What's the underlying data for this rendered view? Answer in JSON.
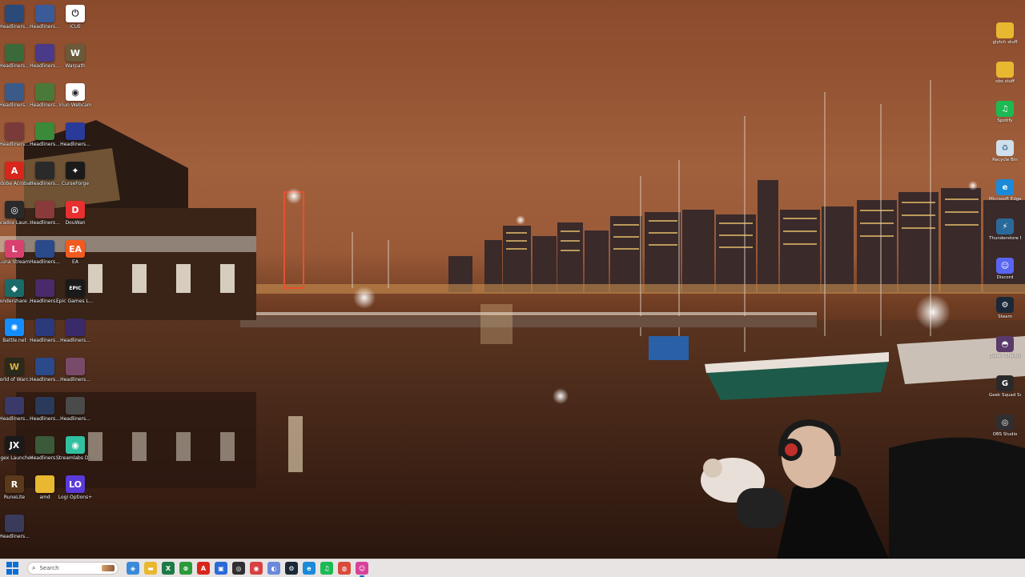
{
  "left_icons": [
    {
      "label": "Headliners...",
      "color": "#2a4a7a",
      "glyph": ""
    },
    {
      "label": "Headliners...",
      "color": "#3a5a9a",
      "glyph": ""
    },
    {
      "label": "iCUE",
      "color": "#ffffff",
      "glyph": "⏻",
      "fg": "#2a2a2a"
    },
    {
      "label": "Headliners...",
      "color": "#3a6a3a",
      "glyph": ""
    },
    {
      "label": "Headliners...",
      "color": "#4a3a8a",
      "glyph": ""
    },
    {
      "label": "Warpath",
      "color": "#6a5a3a",
      "glyph": "W"
    },
    {
      "label": "Headliners...",
      "color": "#3a5a8a",
      "glyph": ""
    },
    {
      "label": "Headliners...",
      "color": "#4a7a3a",
      "glyph": ""
    },
    {
      "label": "Iriun Webcam",
      "color": "#ffffff",
      "glyph": "◉",
      "fg": "#222"
    },
    {
      "label": "Headliners...",
      "color": "#7a3a3a",
      "glyph": ""
    },
    {
      "label": "Headliners...",
      "color": "#3a8a3a",
      "glyph": ""
    },
    {
      "label": "Headliners...",
      "color": "#2a3a9a",
      "glyph": ""
    },
    {
      "label": "Adobe Acrobat",
      "color": "#d9261c",
      "glyph": "A"
    },
    {
      "label": "Headliners...",
      "color": "#2a2a2a",
      "glyph": ""
    },
    {
      "label": "CurseForge",
      "color": "#1a1a1a",
      "glyph": "✦"
    },
    {
      "label": "Paradox Launcher v2",
      "color": "#2a2a2a",
      "glyph": "◎"
    },
    {
      "label": "Headliners...",
      "color": "#8a3a3a",
      "glyph": ""
    },
    {
      "label": "DouWan",
      "color": "#e83030",
      "glyph": "D"
    },
    {
      "label": "Luna Stream",
      "color": "#d94070",
      "glyph": "L"
    },
    {
      "label": "Headliners...",
      "color": "#2a4a8a",
      "glyph": ""
    },
    {
      "label": "EA",
      "color": "#f25a20",
      "glyph": "EA"
    },
    {
      "label": "Wondershare Filmora 14",
      "color": "#1a6a6a",
      "glyph": "◆"
    },
    {
      "label": "Headliners...",
      "color": "#4a2a6a",
      "glyph": ""
    },
    {
      "label": "Epic Games Launcher",
      "color": "#1a1a1a",
      "glyph": "EPIC"
    },
    {
      "label": "Battle.net",
      "color": "#148eff",
      "glyph": "✺"
    },
    {
      "label": "Headliners...",
      "color": "#2a3a7a",
      "glyph": ""
    },
    {
      "label": "Headliners...",
      "color": "#3a2a6a",
      "glyph": ""
    },
    {
      "label": "World of Warcraft",
      "color": "#2a2a1a",
      "glyph": "W",
      "fg": "#e0b040"
    },
    {
      "label": "Headliners...",
      "color": "#2a4a8a",
      "glyph": ""
    },
    {
      "label": "Headliners...",
      "color": "#7a4a6a",
      "glyph": ""
    },
    {
      "label": "Headliners...",
      "color": "#3a3a6a",
      "glyph": ""
    },
    {
      "label": "Headliners...",
      "color": "#2a3a5a",
      "glyph": ""
    },
    {
      "label": "Headliners...",
      "color": "#4a4a4a",
      "glyph": ""
    },
    {
      "label": "Jagex Launcher",
      "color": "#1a1a1a",
      "glyph": "JX"
    },
    {
      "label": "Headliners...",
      "color": "#3a5a3a",
      "glyph": ""
    },
    {
      "label": "Streamlabs Desktop",
      "color": "#30c0a0",
      "glyph": "◉"
    },
    {
      "label": "RuneLite",
      "color": "#5a3a1a",
      "glyph": "R"
    },
    {
      "label": "amd",
      "color": "#e8b830",
      "glyph": ""
    },
    {
      "label": "Logi Options+",
      "color": "#5a3ad9",
      "glyph": "LO"
    },
    {
      "label": "Headliners...",
      "color": "#3a3a5a",
      "glyph": ""
    }
  ],
  "right_icons": [
    {
      "label": "glytch stuff",
      "color": "#e8b830",
      "glyph": ""
    },
    {
      "label": "obs stuff",
      "color": "#e8b830",
      "glyph": ""
    },
    {
      "label": "Spotify",
      "color": "#1db954",
      "glyph": "♫"
    },
    {
      "label": "Recycle Bin",
      "color": "#cfe0ec",
      "glyph": "♻",
      "fg": "#4a7a9a"
    },
    {
      "label": "Microsoft Edge",
      "color": "#1a8ad9",
      "glyph": "e"
    },
    {
      "label": "Thunderstore Mod Mana...",
      "color": "#2a6a9a",
      "glyph": "⚡"
    },
    {
      "label": "Discord",
      "color": "#5865f2",
      "glyph": "☺"
    },
    {
      "label": "Steam",
      "color": "#1b2838",
      "glyph": "⚙"
    },
    {
      "label": "Dune - Shortcut",
      "color": "#5a3a6a",
      "glyph": "◓"
    },
    {
      "label": "Geek Squad Support.exe",
      "color": "#2a2a2a",
      "glyph": "G"
    },
    {
      "label": "OBS Studio",
      "color": "#302e31",
      "glyph": "◎"
    }
  ],
  "taskbar": {
    "search_placeholder": "Search",
    "apps": [
      {
        "name": "copilot-icon",
        "color": "#3a8ad9",
        "glyph": "◈"
      },
      {
        "name": "file-explorer-icon",
        "color": "#e8b830",
        "glyph": "▬"
      },
      {
        "name": "excel-icon",
        "color": "#1e7a44",
        "glyph": "X"
      },
      {
        "name": "xbox-icon",
        "color": "#2a9a3a",
        "glyph": "⊗"
      },
      {
        "name": "acrobat-icon",
        "color": "#d9261c",
        "glyph": "A"
      },
      {
        "name": "store-icon",
        "color": "#2a6ad9",
        "glyph": "▣"
      },
      {
        "name": "obs-icon",
        "color": "#302e31",
        "glyph": "◎"
      },
      {
        "name": "screen-capture-icon",
        "color": "#d94040",
        "glyph": "◉"
      },
      {
        "name": "app-icon",
        "color": "#6a8ad9",
        "glyph": "◐"
      },
      {
        "name": "steam-icon",
        "color": "#1b2838",
        "glyph": "⚙"
      },
      {
        "name": "edge-icon",
        "color": "#1a8ad9",
        "glyph": "e"
      },
      {
        "name": "spotify-icon",
        "color": "#1db954",
        "glyph": "♫"
      },
      {
        "name": "chrome-icon",
        "color": "#d94a3a",
        "glyph": "◍"
      },
      {
        "name": "discord-icon",
        "color": "#d9409a",
        "glyph": "☺"
      }
    ]
  }
}
